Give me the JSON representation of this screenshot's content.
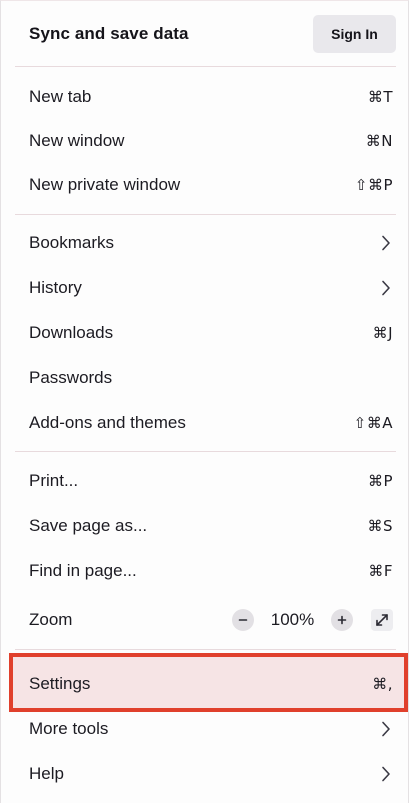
{
  "header": {
    "title": "Sync and save data",
    "sign_in_label": "Sign In"
  },
  "menu": {
    "new_tab": {
      "label": "New tab",
      "shortcut": "⌘T"
    },
    "new_window": {
      "label": "New window",
      "shortcut": "⌘N"
    },
    "new_private_window": {
      "label": "New private window",
      "shortcut": "⇧⌘P"
    },
    "bookmarks": {
      "label": "Bookmarks",
      "icon": "chevron-right-icon"
    },
    "history": {
      "label": "History",
      "icon": "chevron-right-icon"
    },
    "downloads": {
      "label": "Downloads",
      "shortcut": "⌘J"
    },
    "passwords": {
      "label": "Passwords"
    },
    "addons": {
      "label": "Add-ons and themes",
      "shortcut": "⇧⌘A"
    },
    "print": {
      "label": "Print...",
      "shortcut": "⌘P"
    },
    "save_page": {
      "label": "Save page as...",
      "shortcut": "⌘S"
    },
    "find_in_page": {
      "label": "Find in page...",
      "shortcut": "⌘F"
    },
    "zoom": {
      "label": "Zoom",
      "value": "100%",
      "minus_icon": "minus-icon",
      "plus_icon": "plus-icon",
      "fullscreen_icon": "fullscreen-icon"
    },
    "settings": {
      "label": "Settings",
      "shortcut": "⌘,"
    },
    "more_tools": {
      "label": "More tools",
      "icon": "chevron-right-icon"
    },
    "help": {
      "label": "Help",
      "icon": "chevron-right-icon"
    }
  },
  "colors": {
    "highlight_border": "#e0402c",
    "highlight_fill": "#f6e4e5",
    "separator": "#e8dadd",
    "text": "#1c1b22",
    "button_bg": "#e9e8ec"
  }
}
